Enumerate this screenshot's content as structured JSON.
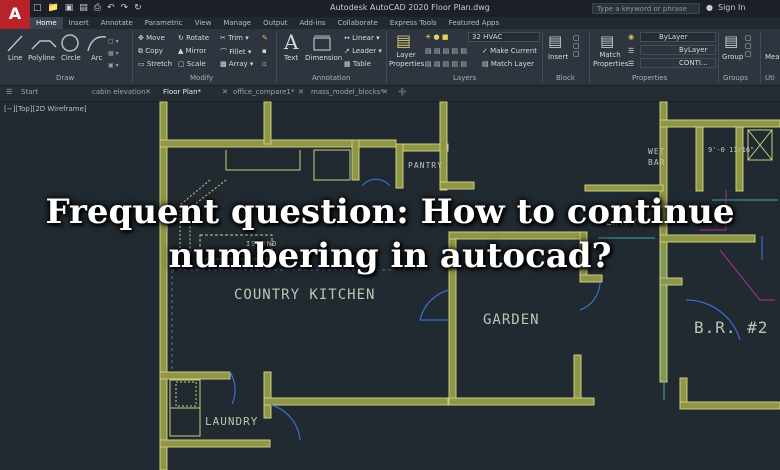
{
  "app": {
    "logo": "A",
    "title": "Autodesk AutoCAD 2020   Floor Plan.dwg",
    "search_placeholder": "Type a keyword or phrase",
    "signin": "Sign In"
  },
  "menu": [
    "Home",
    "Insert",
    "Annotate",
    "Parametric",
    "View",
    "Manage",
    "Output",
    "Add-ins",
    "Collaborate",
    "Express Tools",
    "Featured Apps"
  ],
  "ribbon": {
    "draw": {
      "line": "Line",
      "polyline": "Polyline",
      "circle": "Circle",
      "arc": "Arc",
      "title": "Draw"
    },
    "modify": {
      "move": "Move",
      "rotate": "Rotate",
      "trim": "Trim",
      "copy": "Copy",
      "mirror": "Mirror",
      "fillet": "Fillet",
      "stretch": "Stretch",
      "scale": "Scale",
      "array": "Array",
      "title": "Modify"
    },
    "annotation": {
      "text": "Text",
      "dimension": "Dimension",
      "linear": "Linear",
      "leader": "Leader",
      "table": "Table",
      "title": "Annotation"
    },
    "layers": {
      "properties": "Layer Properties",
      "current_layer": "32 HVAC",
      "make_current": "Make Current",
      "match_layer": "Match Layer",
      "title": "Layers"
    },
    "block": {
      "insert": "Insert",
      "title": "Block"
    },
    "properties": {
      "match": "Match Properties",
      "bylayer1": "ByLayer",
      "bylayer2": "ByLayer",
      "continuous": "CONTI...",
      "title": "Properties"
    },
    "groups": {
      "group": "Group",
      "title": "Groups"
    },
    "utilities": {
      "measure": "Mea...",
      "title": "Uti"
    }
  },
  "doc_tabs": [
    "Start",
    "cabin elevation",
    "Floor Plan*",
    "office_compare1*",
    "mass_model_blocks*"
  ],
  "viewport_label": "[−][Top][2D Wireframe]",
  "rooms": {
    "pantry": "PANTRY",
    "island": "ISLAND",
    "kitchen": "COUNTRY KITCHEN",
    "garden": "GARDEN",
    "wet_bar": "WET BAR",
    "dimension": "9'-0 11/16\"",
    "entry": "ENTRY",
    "br2": "B.R. #2",
    "laundry": "LAUNDRY"
  },
  "headline": "Frequent question: How to continue numbering in autocad?",
  "colors": {
    "wall": "#c8cf7a",
    "wall_fill": "#9fa64e",
    "door": "#3a6fd0",
    "magenta": "#b0309a",
    "cyan": "#47a7a7",
    "logo": "#b8232a"
  }
}
